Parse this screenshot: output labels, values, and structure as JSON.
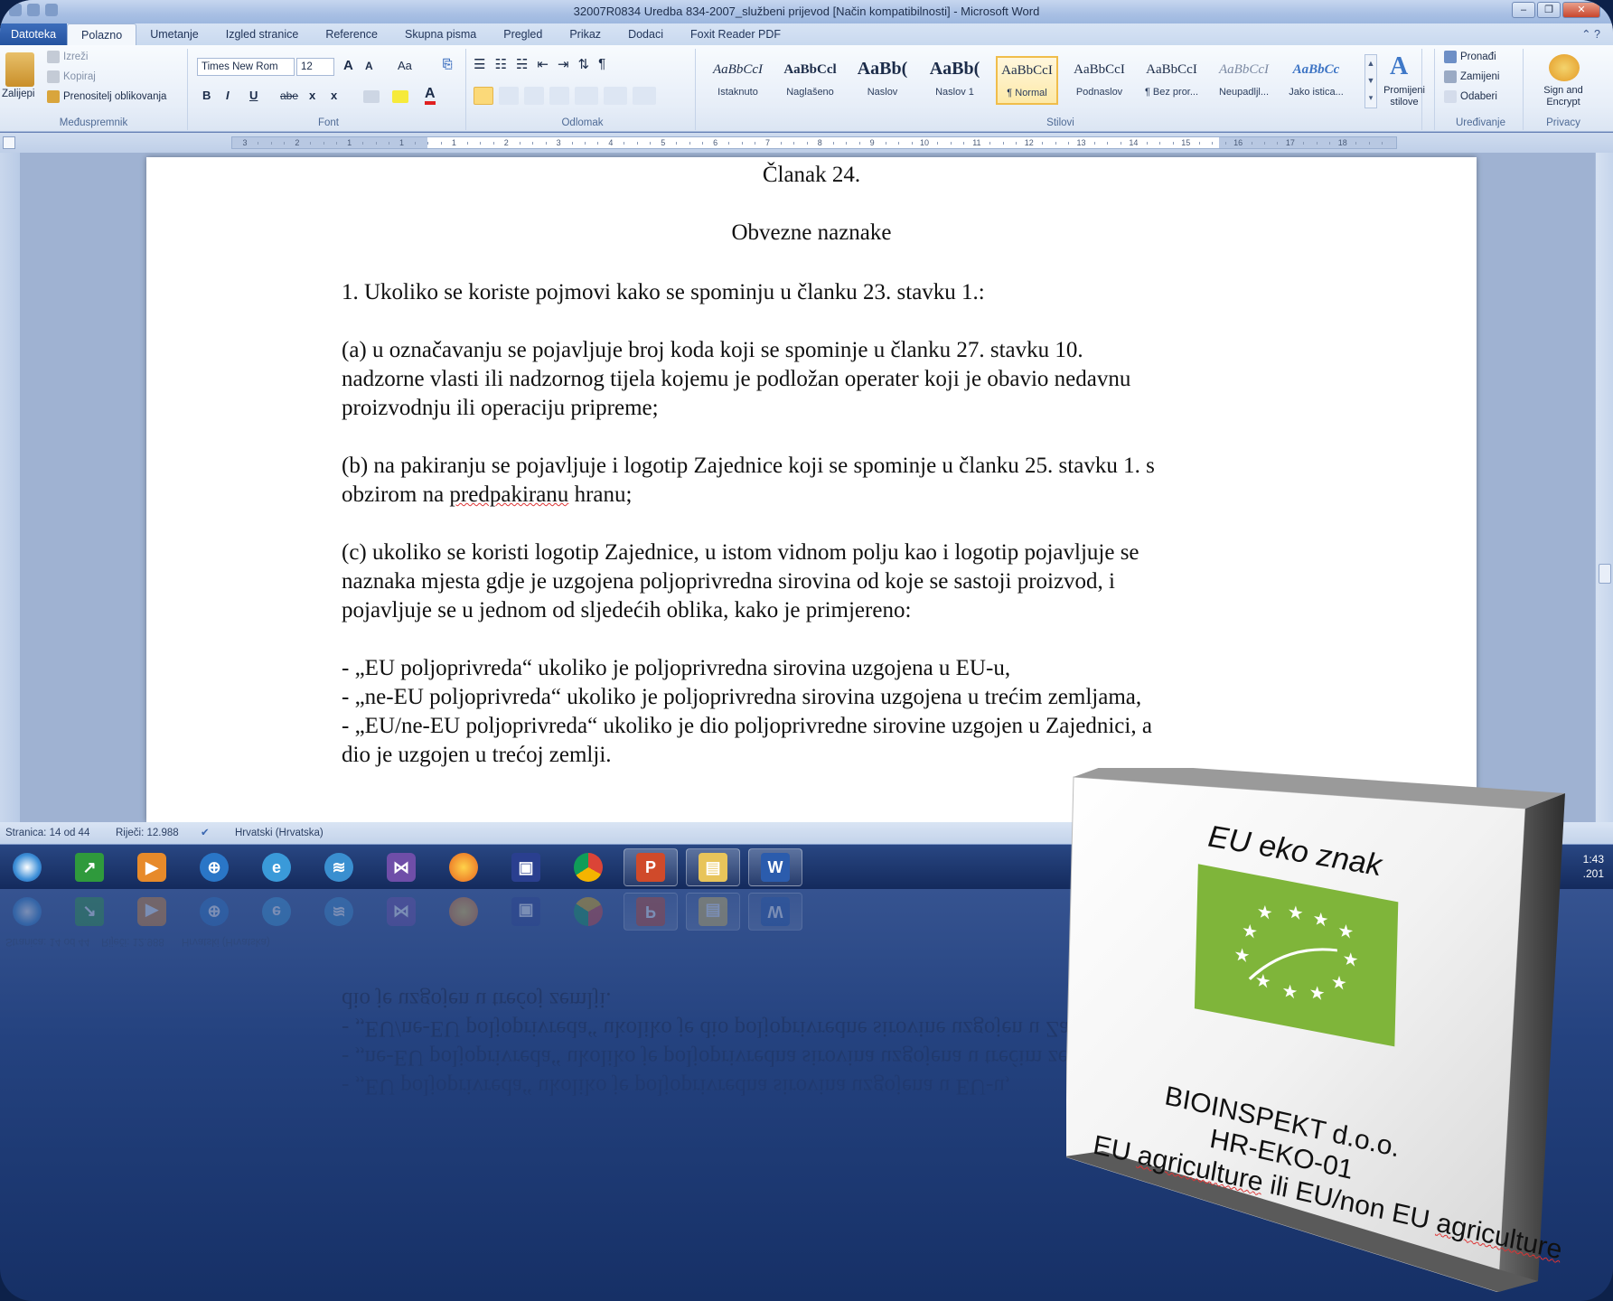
{
  "window": {
    "title": "32007R0834 Uredba 834-2007_službeni prijevod [Način kompatibilnosti] - Microsoft Word"
  },
  "tabs": [
    "Datoteka",
    "Polazno",
    "Umetanje",
    "Izgled stranice",
    "Reference",
    "Skupna pisma",
    "Pregled",
    "Prikaz",
    "Dodaci",
    "Foxit Reader PDF"
  ],
  "ribbon": {
    "clipboard": {
      "label": "Međuspremnik",
      "paste": "Zalijepi",
      "cut": "Izreži",
      "copy": "Kopiraj",
      "format_painter": "Prenositelj oblikovanja"
    },
    "font": {
      "label": "Font",
      "font_name": "Times New Rom",
      "font_size": "12",
      "grow": "A",
      "shrink": "A",
      "change_case": "Aa",
      "bold": "B",
      "italic": "I",
      "underline": "U",
      "strike": "abe",
      "subscript": "x",
      "superscript": "x"
    },
    "paragraph": {
      "label": "Odlomak"
    },
    "styles": {
      "label": "Stilovi",
      "items": [
        {
          "sample": "AaBbCcI",
          "name": "Istaknuto"
        },
        {
          "sample": "AaBbCcl",
          "name": "Naglašeno"
        },
        {
          "sample": "AaBb(",
          "name": "Naslov"
        },
        {
          "sample": "AaBb(",
          "name": "Naslov 1"
        },
        {
          "sample": "AaBbCcI",
          "name": "¶ Normal"
        },
        {
          "sample": "AaBbCcI",
          "name": "Podnaslov"
        },
        {
          "sample": "AaBbCcI",
          "name": "¶ Bez pror..."
        },
        {
          "sample": "AaBbCcI",
          "name": "Neupadljl..."
        },
        {
          "sample": "AaBbCc",
          "name": "Jako istica..."
        }
      ],
      "change_styles": "Promijeni stilove"
    },
    "editing": {
      "label": "Uređivanje",
      "find": "Pronađi",
      "replace": "Zamijeni",
      "select": "Odaberi"
    },
    "privacy": {
      "label": "Privacy",
      "sign": "Sign and Encrypt"
    }
  },
  "ruler": {
    "numbers": [
      "3",
      "2",
      "1",
      "1",
      "1",
      "2",
      "3",
      "4",
      "5",
      "6",
      "7",
      "8",
      "9",
      "10",
      "11",
      "12",
      "13",
      "14",
      "15",
      "16",
      "17",
      "18"
    ]
  },
  "document": {
    "article": "Članak 24.",
    "heading": "Obvezne naznake",
    "p1": "1. Ukoliko se koriste pojmovi kako se spominju u članku 23. stavku 1.:",
    "pa": [
      "(a) u označavanju se pojavljuje broj koda koji se spominje u članku 27. stavku 10.",
      "nadzorne vlasti ili nadzornog tijela kojemu je podložan operater koji je obavio nedavnu",
      "proizvodnju ili operaciju pripreme;"
    ],
    "pb1": "(b) na pakiranju se pojavljuje i logotip Zajednice koji se spominje u članku 25. stavku 1. s",
    "pb2_pre": "obzirom na ",
    "pb2_err": "predpakiranu",
    "pb2_post": " hranu;",
    "pc": [
      "(c) ukoliko se koristi logotip Zajednice, u istom vidnom polju kao i logotip pojavljuje se",
      "naznaka mjesta gdje je uzgojena poljoprivredna sirovina od koje se sastoji proizvod, i",
      "pojavljuje se u jednom od sljedećih oblika, kako je primjereno:"
    ],
    "dashes": [
      "- „EU poljoprivreda“ ukoliko je poljoprivredna sirovina uzgojena u EU-u,",
      "- „ne-EU poljoprivreda“ ukoliko je poljoprivredna sirovina uzgojena u trećim zemljama,",
      "- „EU/ne-EU poljoprivreda“ ukoliko je dio poljoprivredne sirovine uzgojen u Zajednici, a",
      "dio je uzgojen u trećoj zemlji."
    ]
  },
  "status": {
    "page": "Stranica: 14 od 44",
    "words": "Riječi: 12.988",
    "language": "Hrvatski (Hrvatska)"
  },
  "taskbar": {
    "icons": [
      "start-orb-icon",
      "stock-chart-icon",
      "media-player-icon",
      "globe-icon",
      "internet-explorer-icon",
      "network-icon",
      "visual-studio-icon",
      "firefox-icon",
      "save-disk-icon",
      "chrome-icon",
      "powerpoint-icon",
      "file-explorer-icon",
      "word-icon"
    ],
    "clock_time": "1:43",
    "clock_date": ".201"
  },
  "label_box": {
    "title": "EU eko znak",
    "company": "BIOINSPEKT d.o.o.",
    "code": "HR-EKO-01",
    "origin_pre": "EU ",
    "origin_err1": "agriculture",
    "origin_mid": " ili EU/non EU ",
    "origin_err2": "agriculture",
    "logo_color": "#7fb53a"
  },
  "colors": {
    "background": "#4a67a4",
    "ribbon": "#e7eef8",
    "file_tab": "#2553a0",
    "selected_style": "#fde9a8",
    "spell_error": "#dd3333"
  }
}
